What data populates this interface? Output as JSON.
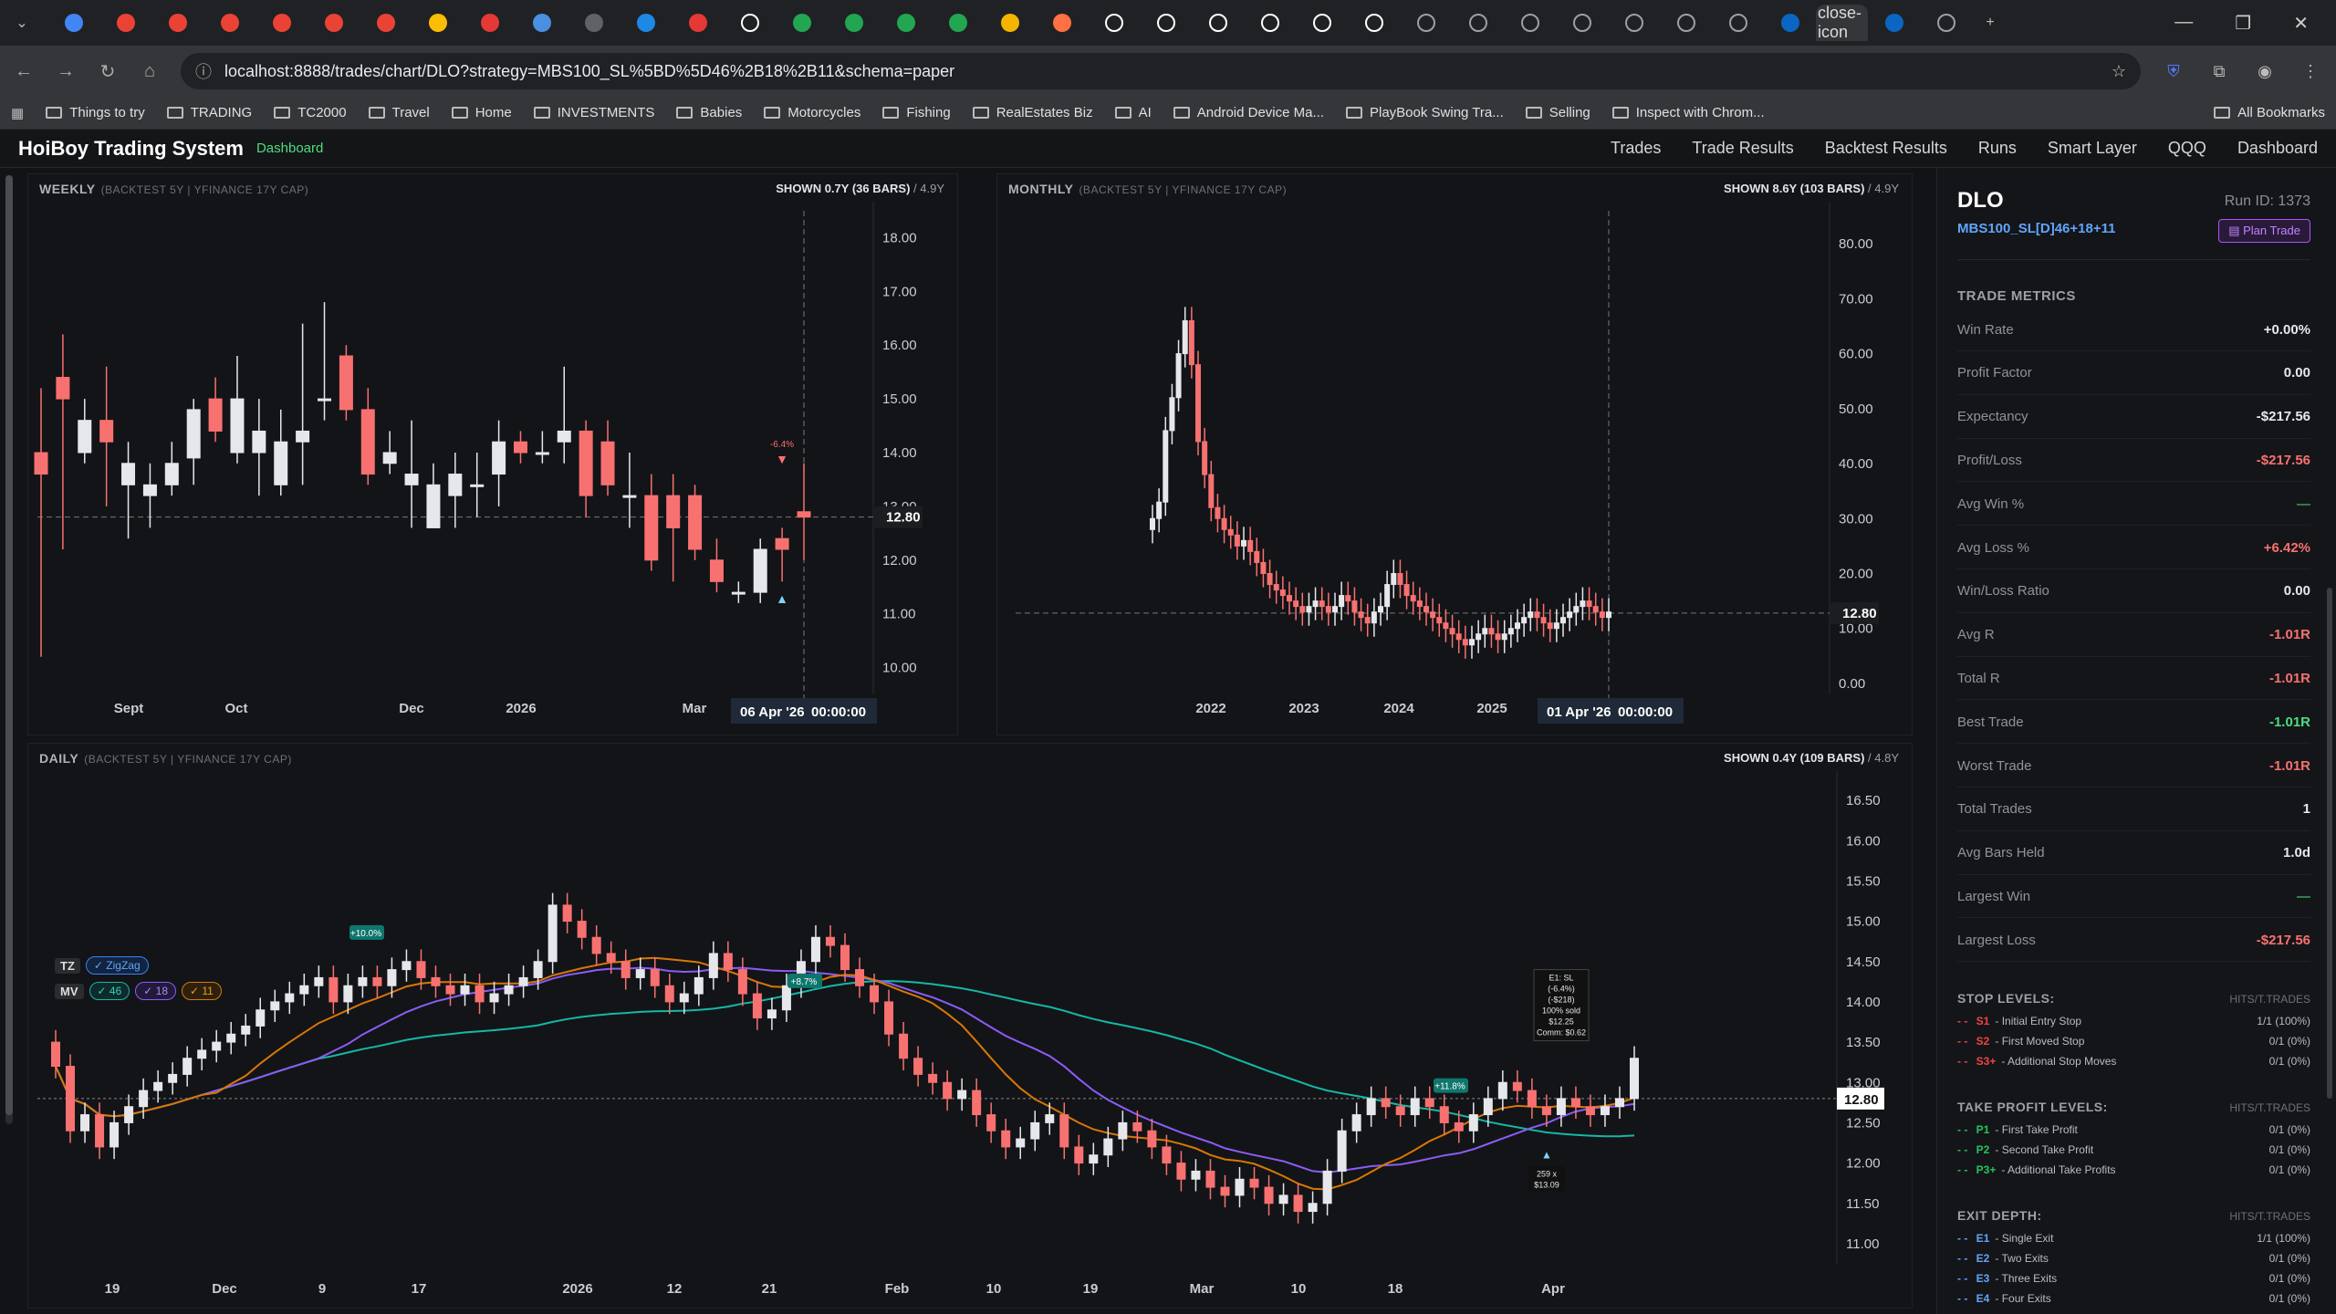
{
  "browser": {
    "active_tab_icon": "close-icon",
    "url": "localhost:8888/trades/chart/DLO?strategy=MBS100_SL%5BD%5D46%2B18%2B11&schema=paper",
    "bookmarks": [
      "Things to try",
      "TRADING",
      "TC2000",
      "Travel",
      "Home",
      "INVESTMENTS",
      "Babies",
      "Motorcycles",
      "Fishing",
      "RealEstates Biz",
      "AI",
      "Android Device Ma...",
      "PlayBook Swing Tra...",
      "Selling",
      "Inspect with Chrom..."
    ],
    "all_bookmarks": "All Bookmarks"
  },
  "app": {
    "title": "HoiBoy Trading System",
    "tag": "Dashboard",
    "nav": [
      "Trades",
      "Trade Results",
      "Backtest Results",
      "Runs",
      "Smart Layer",
      "QQQ",
      "Dashboard"
    ]
  },
  "weekly": {
    "title": "WEEKLY",
    "sub": "(BACKTEST 5Y | YFINANCE 17Y CAP)",
    "shown": "SHOWN 0.7Y (36 BARS)",
    "span": "/ 4.9Y",
    "yticks": [
      "18.00",
      "17.00",
      "16.00",
      "15.00",
      "14.00",
      "13.00",
      "12.00",
      "11.00",
      "10.00"
    ],
    "xticks": [
      "Sept",
      "Oct",
      "Dec",
      "2026",
      "Mar"
    ],
    "price_tag": "12.80",
    "crosshair_date": "06 Apr '26",
    "crosshair_time": "00:00:00",
    "marker": "-6.4%"
  },
  "monthly": {
    "title": "MONTHLY",
    "sub": "(BACKTEST 5Y | YFINANCE 17Y CAP)",
    "shown": "SHOWN 8.6Y (103 BARS)",
    "span": "/ 4.9Y",
    "yticks": [
      "80.00",
      "70.00",
      "60.00",
      "50.00",
      "40.00",
      "30.00",
      "20.00",
      "10.00",
      "0.00"
    ],
    "xticks": [
      "2022",
      "2023",
      "2024",
      "2025"
    ],
    "price_tag": "12.80",
    "crosshair_date": "01 Apr '26",
    "crosshair_time": "00:00:00"
  },
  "daily": {
    "title": "DAILY",
    "sub": "(BACKTEST 5Y | YFINANCE 17Y CAP)",
    "shown": "SHOWN 0.4Y (109 BARS)",
    "span": "/ 4.8Y",
    "yticks": [
      "16.50",
      "16.00",
      "15.50",
      "15.00",
      "14.50",
      "14.00",
      "13.50",
      "13.00",
      "12.50",
      "12.00",
      "11.50",
      "11.00"
    ],
    "xticks": [
      "19",
      "Dec",
      "9",
      "17",
      "2026",
      "12",
      "21",
      "Feb",
      "10",
      "19",
      "Mar",
      "10",
      "18",
      "Apr"
    ],
    "price_tag": "12.80",
    "tz_label": "TZ",
    "zigzag": "✓ ZigZag",
    "mv_label": "MV",
    "mv_chips": [
      "✓ 46",
      "✓ 18",
      "✓ 11"
    ],
    "labels": [
      "+10.0%",
      "+8.7%",
      "+11.8%"
    ],
    "exit_box": [
      "E1: SL",
      "(-6.4%)",
      "(-$218)",
      "100% sold",
      "$12.25",
      "Comm: $0.62"
    ],
    "entry_box": [
      "259 x",
      "$13.09"
    ]
  },
  "trade": {
    "symbol": "DLO",
    "run_id": "Run ID: 1373",
    "strategy": "MBS100_SL[D]46+18+11",
    "plan_button": "Plan Trade",
    "metrics_title": "TRADE METRICS",
    "metrics": [
      {
        "k": "Win Rate",
        "v": "+0.00%",
        "c": ""
      },
      {
        "k": "Profit Factor",
        "v": "0.00",
        "c": ""
      },
      {
        "k": "Expectancy",
        "v": "-$217.56",
        "c": ""
      },
      {
        "k": "Profit/Loss",
        "v": "-$217.56",
        "c": "neg"
      },
      {
        "k": "Avg Win %",
        "v": "—",
        "c": "dim"
      },
      {
        "k": "Avg Loss %",
        "v": "+6.42%",
        "c": "neg"
      },
      {
        "k": "Win/Loss Ratio",
        "v": "0.00",
        "c": ""
      },
      {
        "k": "Avg R",
        "v": "-1.01R",
        "c": "neg"
      },
      {
        "k": "Total R",
        "v": "-1.01R",
        "c": "neg"
      },
      {
        "k": "Best Trade",
        "v": "-1.01R",
        "c": "pos"
      },
      {
        "k": "Worst Trade",
        "v": "-1.01R",
        "c": "neg"
      },
      {
        "k": "Total Trades",
        "v": "1",
        "c": ""
      },
      {
        "k": "Avg Bars Held",
        "v": "1.0d",
        "c": ""
      },
      {
        "k": "Largest Win",
        "v": "—",
        "c": "dim"
      },
      {
        "k": "Largest Loss",
        "v": "-$217.56",
        "c": "neg"
      }
    ],
    "stop_title": "STOP LEVELS:",
    "stop_hits": "HITS/T.TRADES",
    "stops": [
      {
        "tag": "S1",
        "label": "Initial Entry Stop",
        "v": "1/1 (100%)"
      },
      {
        "tag": "S2",
        "label": "First Moved Stop",
        "v": "0/1 (0%)"
      },
      {
        "tag": "S3+",
        "label": "Additional Stop Moves",
        "v": "0/1 (0%)"
      }
    ],
    "tp_title": "TAKE PROFIT LEVELS:",
    "tp_hits": "HITS/T.TRADES",
    "tps": [
      {
        "tag": "P1",
        "label": "First Take Profit",
        "v": "0/1 (0%)"
      },
      {
        "tag": "P2",
        "label": "Second Take Profit",
        "v": "0/1 (0%)"
      },
      {
        "tag": "P3+",
        "label": "Additional Take Profits",
        "v": "0/1 (0%)"
      }
    ],
    "exit_title": "EXIT DEPTH:",
    "exit_hits": "HITS/T.TRADES",
    "exits": [
      {
        "tag": "E1",
        "label": "Single Exit",
        "v": "1/1 (100%)"
      },
      {
        "tag": "E2",
        "label": "Two Exits",
        "v": "0/1 (0%)"
      },
      {
        "tag": "E3",
        "label": "Three Exits",
        "v": "0/1 (0%)"
      },
      {
        "tag": "E4",
        "label": "Four Exits",
        "v": "0/1 (0%)"
      }
    ]
  },
  "chart_data": [
    {
      "type": "candlestick",
      "title": "WEEKLY",
      "ylim": [
        9.5,
        18.5
      ],
      "x": [
        "Sept",
        "Oct",
        "Dec",
        "2026",
        "Mar"
      ],
      "values": [
        [
          14,
          15.2,
          10.2,
          13.6
        ],
        [
          15.4,
          16.2,
          12.2,
          15.0
        ],
        [
          14.0,
          15.0,
          13.8,
          14.6
        ],
        [
          14.6,
          15.6,
          13.0,
          14.2
        ],
        [
          13.4,
          14.2,
          12.4,
          13.8
        ],
        [
          13.2,
          13.8,
          12.6,
          13.4
        ],
        [
          13.4,
          14.2,
          13.2,
          13.8
        ],
        [
          13.9,
          15.0,
          13.4,
          14.8
        ],
        [
          15.0,
          15.4,
          14.2,
          14.4
        ],
        [
          14.0,
          15.8,
          13.8,
          15.0
        ],
        [
          14.0,
          15.0,
          13.2,
          14.4
        ],
        [
          13.4,
          14.8,
          13.2,
          14.2
        ],
        [
          14.2,
          16.4,
          13.4,
          14.4
        ],
        [
          15.0,
          16.8,
          14.6,
          15.0
        ],
        [
          15.8,
          16.0,
          14.6,
          14.8
        ],
        [
          14.8,
          15.2,
          13.4,
          13.6
        ],
        [
          13.8,
          14.4,
          13.6,
          14.0
        ],
        [
          13.4,
          14.6,
          12.6,
          13.6
        ],
        [
          12.6,
          13.8,
          12.6,
          13.4
        ],
        [
          13.2,
          14.0,
          12.6,
          13.6
        ],
        [
          13.4,
          14.0,
          12.8,
          13.4
        ],
        [
          13.6,
          14.6,
          13.0,
          14.2
        ],
        [
          14.2,
          14.4,
          13.8,
          14.0
        ],
        [
          14.0,
          14.4,
          13.8,
          14.0
        ],
        [
          14.2,
          15.6,
          13.8,
          14.4
        ],
        [
          14.4,
          14.6,
          12.8,
          13.2
        ],
        [
          14.2,
          14.6,
          13.2,
          13.4
        ],
        [
          13.2,
          14.0,
          12.6,
          13.2
        ],
        [
          13.2,
          13.6,
          11.8,
          12.0
        ],
        [
          13.2,
          13.6,
          11.6,
          12.6
        ],
        [
          13.2,
          13.4,
          12.0,
          12.2
        ],
        [
          12.0,
          12.4,
          11.4,
          11.6
        ],
        [
          11.4,
          11.6,
          11.2,
          11.4
        ],
        [
          11.4,
          12.4,
          11.2,
          12.2
        ],
        [
          12.4,
          12.6,
          11.6,
          12.2
        ],
        [
          12.9,
          13.8,
          12.0,
          12.8
        ]
      ]
    },
    {
      "type": "candlestick",
      "title": "MONTHLY",
      "ylim": [
        -2,
        86
      ],
      "x": [
        "2022",
        "2023",
        "2024",
        "2025"
      ],
      "series_summary": {
        "start": 32,
        "peak": 68,
        "low": 7,
        "last": 12.8
      }
    },
    {
      "type": "candlestick",
      "title": "DAILY",
      "ylim": [
        10.75,
        16.75
      ],
      "x": [
        "19",
        "Dec",
        "9",
        "17",
        "2026",
        "12",
        "21",
        "Feb",
        "10",
        "19",
        "Mar",
        "10",
        "18",
        "Apr"
      ],
      "series": [
        {
          "name": "46"
        },
        {
          "name": "18"
        },
        {
          "name": "11"
        }
      ],
      "last": 12.8
    }
  ]
}
